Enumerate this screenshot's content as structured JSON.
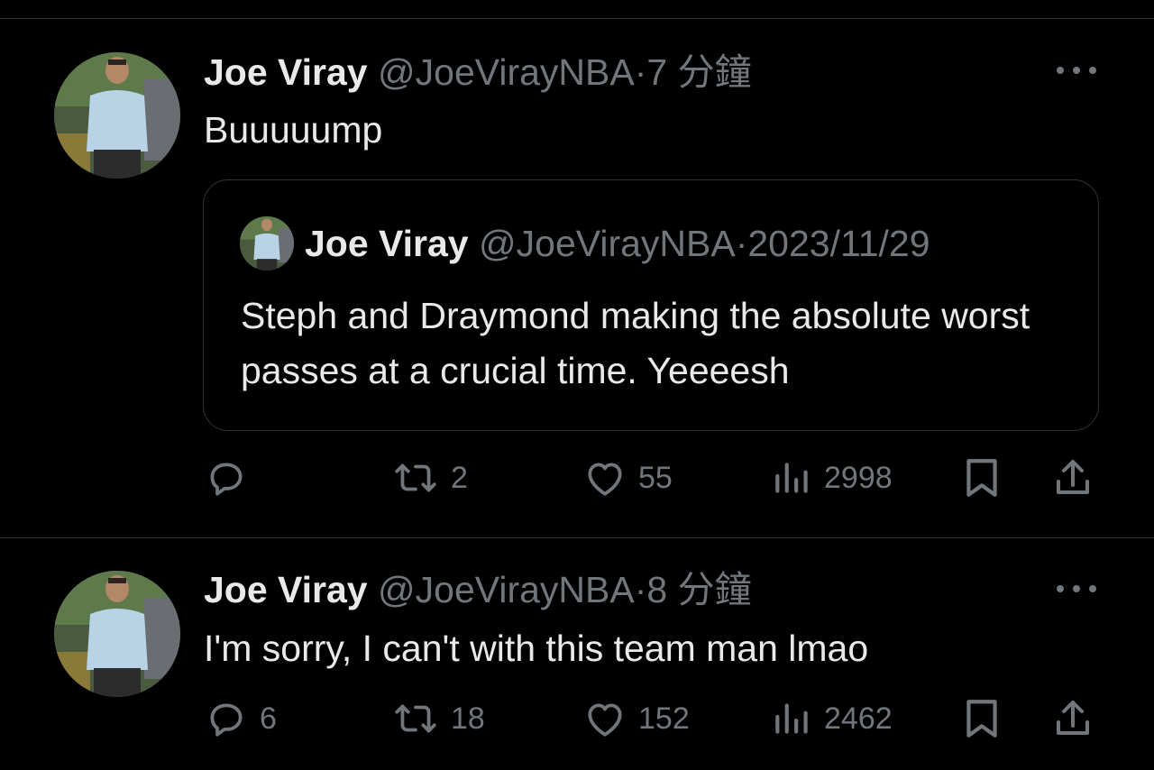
{
  "tweets": [
    {
      "name": "Joe Viray",
      "handle": "@JoeVirayNBA",
      "separator": "·",
      "time": "7 分鐘",
      "text": "Buuuuump",
      "quote": {
        "name": "Joe Viray",
        "handle": "@JoeVirayNBA",
        "separator": "·",
        "date": "2023/11/29",
        "text": "Steph and Draymond making the absolute worst passes at a crucial time. Yeeeesh"
      },
      "actions": {
        "replies": "",
        "retweets": "2",
        "likes": "55",
        "views": "2998"
      }
    },
    {
      "name": "Joe Viray",
      "handle": "@JoeVirayNBA",
      "separator": "·",
      "time": "8 分鐘",
      "text": "I'm sorry, I can't with this team man lmao",
      "actions": {
        "replies": "6",
        "retweets": "18",
        "likes": "152",
        "views": "2462"
      }
    }
  ],
  "colors": {
    "background": "#000000",
    "primary_text": "#e7e9ea",
    "secondary_text": "#71767b",
    "border": "#2f3336"
  },
  "icons": [
    "reply-icon",
    "retweet-icon",
    "like-icon",
    "views-icon",
    "bookmark-icon",
    "share-icon",
    "more-icon"
  ]
}
